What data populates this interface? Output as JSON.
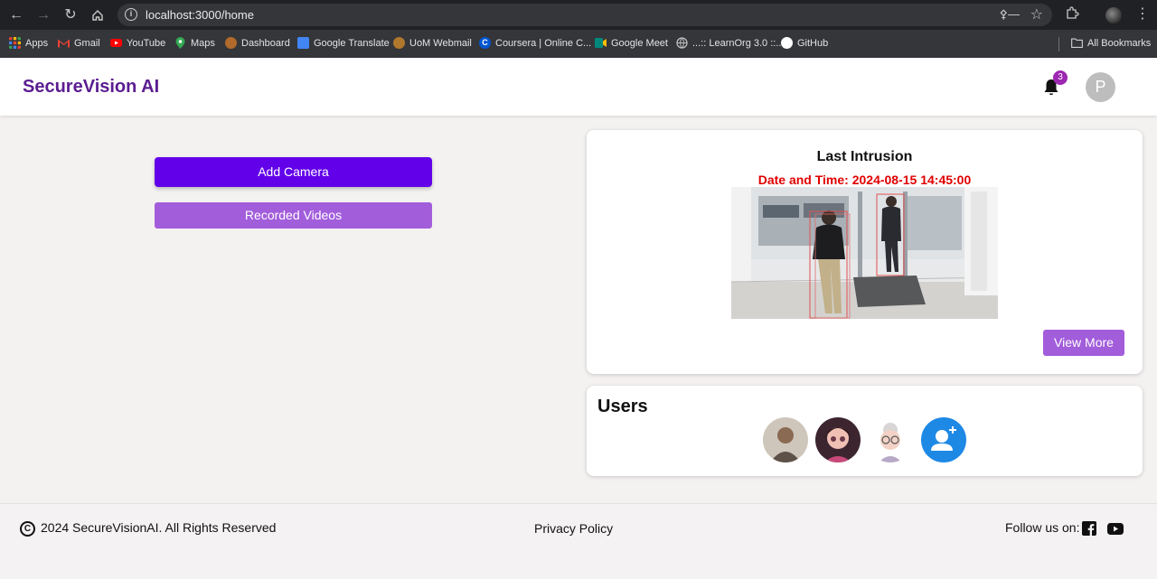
{
  "browser": {
    "url": "localhost:3000/home",
    "bookmarks": [
      {
        "label": "Apps",
        "icon": "apps-grid-icon",
        "color": "#e8453c"
      },
      {
        "label": "Gmail",
        "icon": "gmail-icon",
        "color": "#ea4335"
      },
      {
        "label": "YouTube",
        "icon": "youtube-icon",
        "color": "#ff0000"
      },
      {
        "label": "Maps",
        "icon": "maps-icon",
        "color": "#34a853"
      },
      {
        "label": "Dashboard",
        "icon": "dashboard-icon",
        "color": "#b06a2c"
      },
      {
        "label": "Google Translate",
        "icon": "translate-icon",
        "color": "#4285f4"
      },
      {
        "label": "UoM Webmail",
        "icon": "uom-icon",
        "color": "#b0782c"
      },
      {
        "label": "Coursera | Online C...",
        "icon": "coursera-icon",
        "color": "#0056d2"
      },
      {
        "label": "Google Meet",
        "icon": "meet-icon",
        "color": "#00897b"
      },
      {
        "label": "...:: LearnOrg 3.0 ::...",
        "icon": "globe-icon",
        "color": "#9e9e9e"
      },
      {
        "label": "GitHub",
        "icon": "github-icon",
        "color": "#ffffff"
      }
    ],
    "all_bookmarks": "All Bookmarks"
  },
  "header": {
    "brand": "SecureVision AI",
    "notification_count": "3",
    "avatar_initial": "P"
  },
  "actions": {
    "add_camera": "Add Camera",
    "recorded_videos": "Recorded Videos"
  },
  "intrusion": {
    "title": "Last Intrusion",
    "date_time": "Date and Time: 2024-08-15 14:45:00",
    "view_more": "View More"
  },
  "users": {
    "title": "Users"
  },
  "footer": {
    "copyright": "2024 SecureVisionAI. All Rights Reserved",
    "privacy": "Privacy Policy",
    "follow": "Follow us on:"
  },
  "colors": {
    "brand": "#5b1d91",
    "primary_button": "#6200ea",
    "secondary_button": "#a25ddb",
    "alert": "#e00000",
    "badge": "#9c27b0"
  }
}
